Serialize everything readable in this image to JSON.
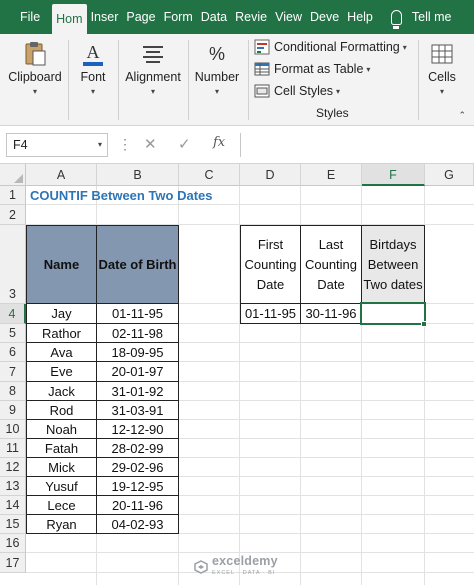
{
  "tabs": [
    {
      "label": "File"
    },
    {
      "label": "Hom",
      "active": true
    },
    {
      "label": "Inser"
    },
    {
      "label": "Page"
    },
    {
      "label": "Form"
    },
    {
      "label": "Data"
    },
    {
      "label": "Revie"
    },
    {
      "label": "View"
    },
    {
      "label": "Deve"
    },
    {
      "label": "Help"
    }
  ],
  "tell_me": "Tell me",
  "ribbon": {
    "clipboard": "Clipboard",
    "font": "Font",
    "alignment": "Alignment",
    "number": "Number",
    "percent_glyph": "%",
    "conditional_formatting": "Conditional Formatting",
    "format_as_table": "Format as Table",
    "cell_styles": "Cell Styles",
    "styles": "Styles",
    "cells": "Cells",
    "accent_color": "#217346"
  },
  "formula_bar": {
    "name_box": "F4",
    "fx": "fx",
    "cancel_glyph": "✕",
    "enter_glyph": "✓",
    "formula": ""
  },
  "columns": [
    "A",
    "B",
    "C",
    "D",
    "E",
    "F",
    "G"
  ],
  "selected_column": "F",
  "rows": [
    "1",
    "2",
    "3",
    "4",
    "5",
    "6",
    "7",
    "8",
    "9",
    "10",
    "11",
    "12",
    "13",
    "14",
    "15",
    "16",
    "17"
  ],
  "selected_row": "4",
  "sheet": {
    "title": "COUNTIF Between Two Dates",
    "table_headers": [
      "Name",
      "Date of Birth"
    ],
    "people": [
      {
        "name": "Jay",
        "dob": "01-11-95"
      },
      {
        "name": "Rathor",
        "dob": "02-11-98"
      },
      {
        "name": "Ava",
        "dob": "18-09-95"
      },
      {
        "name": "Eve",
        "dob": "20-01-97"
      },
      {
        "name": "Jack",
        "dob": "31-01-92"
      },
      {
        "name": "Rod",
        "dob": "31-03-91"
      },
      {
        "name": "Noah",
        "dob": "12-12-90"
      },
      {
        "name": "Fatah",
        "dob": "28-02-99"
      },
      {
        "name": "Mick",
        "dob": "29-02-96"
      },
      {
        "name": "Yusuf",
        "dob": "19-12-95"
      },
      {
        "name": "Lece",
        "dob": "20-11-96"
      },
      {
        "name": "Ryan",
        "dob": "04-02-93"
      }
    ],
    "criteria_headers": [
      "First Counting Date",
      "Last Counting Date",
      "Birtdays Between Two dates"
    ],
    "criteria_values": [
      "01-11-95",
      "30-11-96",
      ""
    ],
    "header_fill": "#8497b0",
    "title_color": "#2e75b6"
  },
  "watermark": {
    "name": "exceldemy",
    "tagline": "EXCEL · DATA · BI"
  }
}
